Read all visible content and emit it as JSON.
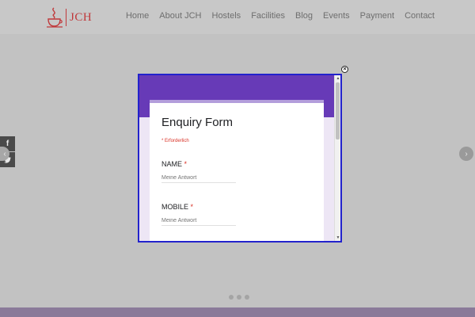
{
  "logo": {
    "text": "JCH"
  },
  "nav": {
    "items": [
      "Home",
      "About JCH",
      "Hostels",
      "Facilities",
      "Blog",
      "Events",
      "Payment",
      "Contact"
    ]
  },
  "social": {
    "facebook": "f",
    "twitter": "t"
  },
  "slider": {
    "prev": "‹",
    "next": "›",
    "dots": 3
  },
  "popup": {
    "close": "×",
    "form": {
      "title": "Enquiry Form",
      "required_note": "* Erforderlich",
      "questions": [
        {
          "label": "NAME",
          "required": "*",
          "placeholder": "Meine Antwort"
        },
        {
          "label": "MOBILE",
          "required": "*",
          "placeholder": "Meine Antwort"
        }
      ]
    }
  },
  "colors": {
    "brand": "#c0393b",
    "form_header": "#673ab7",
    "required": "#d93025",
    "popup_border": "#2222cc"
  }
}
